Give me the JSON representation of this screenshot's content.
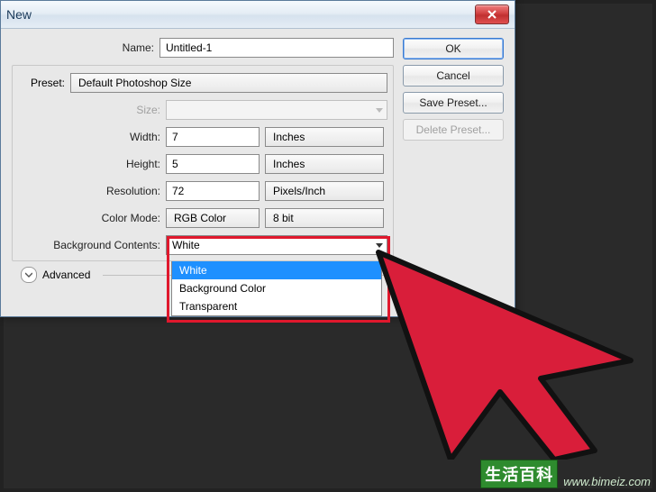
{
  "window": {
    "title": "New"
  },
  "buttons": {
    "ok": "OK",
    "cancel": "Cancel",
    "save_preset": "Save Preset...",
    "delete_preset": "Delete Preset..."
  },
  "labels": {
    "name": "Name:",
    "preset": "Preset:",
    "size": "Size:",
    "width": "Width:",
    "height": "Height:",
    "resolution": "Resolution:",
    "color_mode": "Color Mode:",
    "bg": "Background Contents:",
    "advanced": "Advanced"
  },
  "values": {
    "name": "Untitled-1",
    "preset": "Default Photoshop Size",
    "size": "",
    "width": "7",
    "width_unit": "Inches",
    "height": "5",
    "height_unit": "Inches",
    "resolution": "72",
    "resolution_unit": "Pixels/Inch",
    "color_mode": "RGB Color",
    "bit_depth": "8 bit",
    "bg": "White"
  },
  "bg_options": [
    "White",
    "Background Color",
    "Transparent"
  ],
  "watermark": {
    "badge": "生活百科",
    "url": "www.bimeiz.com"
  }
}
